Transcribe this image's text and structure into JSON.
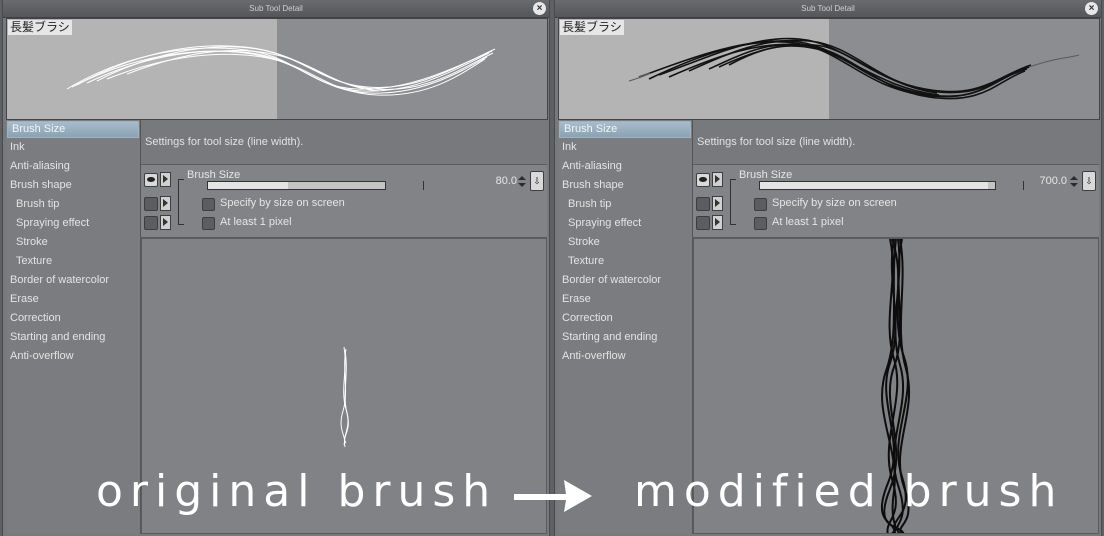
{
  "panels": {
    "left": {
      "window_title": "Sub Tool Detail",
      "preset_name": "長髪ブラシ",
      "description": "Settings for tool size (line width).",
      "brush_size_label": "Brush Size",
      "brush_size_value": "80.0",
      "brush_size_fraction": 0.45,
      "specify_label": "Specify by size on screen",
      "at_least_label": "At least 1 pixel",
      "stroke_color": "#ffffff"
    },
    "right": {
      "window_title": "Sub Tool Detail",
      "preset_name": "長髪ブラシ",
      "description": "Settings for tool size (line width).",
      "brush_size_label": "Brush Size",
      "brush_size_value": "700.0",
      "brush_size_fraction": 0.97,
      "specify_label": "Specify by size on screen",
      "at_least_label": "At least 1 pixel",
      "stroke_color": "#111111"
    }
  },
  "categories": [
    {
      "label": "Brush Size",
      "sub": false,
      "selected": true
    },
    {
      "label": "Ink",
      "sub": false
    },
    {
      "label": "Anti-aliasing",
      "sub": false
    },
    {
      "label": "Brush shape",
      "sub": false
    },
    {
      "label": "Brush tip",
      "sub": true
    },
    {
      "label": "Spraying effect",
      "sub": true
    },
    {
      "label": "Stroke",
      "sub": true
    },
    {
      "label": "Texture",
      "sub": true
    },
    {
      "label": "Border of watercolor",
      "sub": false
    },
    {
      "label": "Erase",
      "sub": false
    },
    {
      "label": "Correction",
      "sub": false
    },
    {
      "label": "Starting and ending",
      "sub": false
    },
    {
      "label": "Anti-overflow",
      "sub": false
    }
  ],
  "captions": {
    "left": "original brush",
    "right": "modified brush"
  },
  "icons": {
    "close": "close-icon",
    "eye": "eye-icon",
    "expand": "expand-triangle-icon",
    "pressure": "pressure-icon",
    "arrow": "right-arrow-icon"
  }
}
